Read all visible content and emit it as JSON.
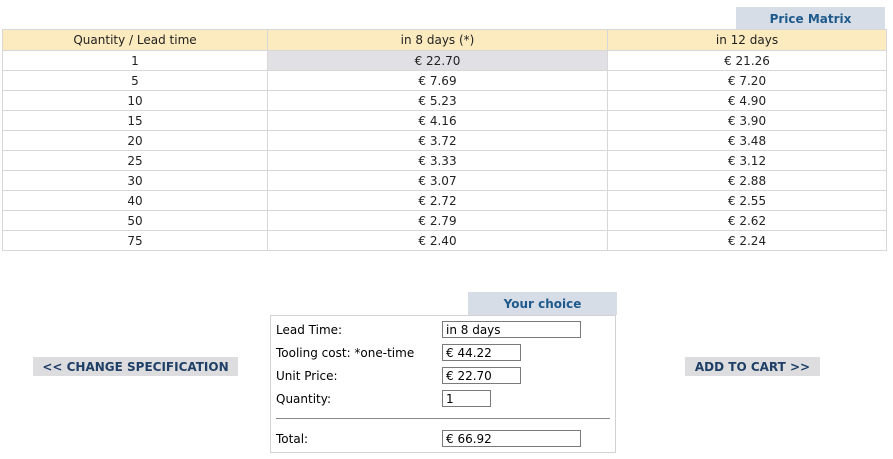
{
  "price_matrix": {
    "title": "Price Matrix",
    "headers": [
      "Quantity / Lead time",
      "in 8 days (*)",
      "in 12 days"
    ],
    "rows": [
      [
        "1",
        "€ 22.70",
        "€ 21.26"
      ],
      [
        "5",
        "€ 7.69",
        "€ 7.20"
      ],
      [
        "10",
        "€ 5.23",
        "€ 4.90"
      ],
      [
        "15",
        "€ 4.16",
        "€ 3.90"
      ],
      [
        "20",
        "€ 3.72",
        "€ 3.48"
      ],
      [
        "25",
        "€ 3.33",
        "€ 3.12"
      ],
      [
        "30",
        "€ 3.07",
        "€ 2.88"
      ],
      [
        "40",
        "€ 2.72",
        "€ 2.55"
      ],
      [
        "50",
        "€ 2.79",
        "€ 2.62"
      ],
      [
        "75",
        "€ 2.40",
        "€ 2.24"
      ]
    ],
    "selected_cell": {
      "row": 0,
      "col": 1
    }
  },
  "choice": {
    "title": "Your choice",
    "lead_time_label": "Lead Time:",
    "lead_time_value": "in 8 days",
    "tooling_label": "Tooling cost: *one-time",
    "tooling_value": "€ 44.22",
    "unit_price_label": "Unit Price:",
    "unit_price_value": "€ 22.70",
    "quantity_label": "Quantity:",
    "quantity_value": "1",
    "total_label": "Total:",
    "total_value": "€ 66.92"
  },
  "actions": {
    "change_spec_label": "<< CHANGE SPECIFICATION",
    "add_to_cart_label": "ADD TO CART >>"
  },
  "colors": {
    "header_bg": "#fcebbf",
    "tab_bg": "#d7dde6",
    "tab_text": "#1f5a8c",
    "selected_cell_bg": "#e1e1e5",
    "button_bg": "#dddde0"
  }
}
